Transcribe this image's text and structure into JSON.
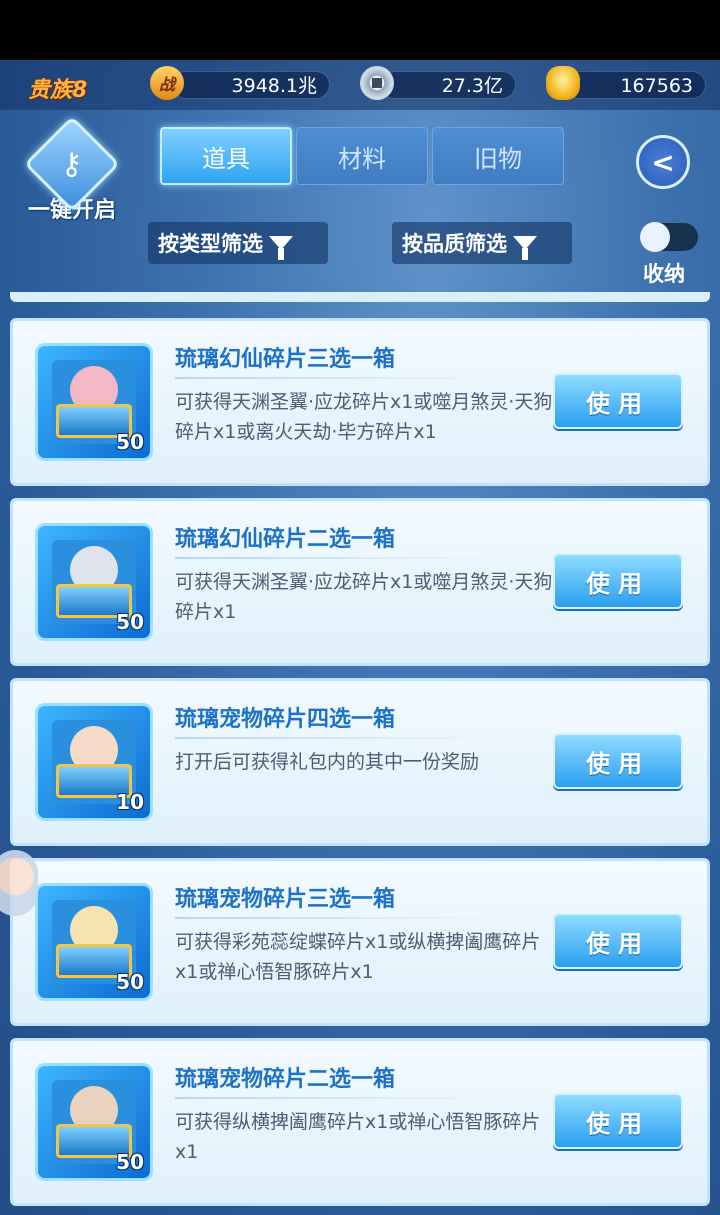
{
  "header": {
    "vip_label": "贵族8",
    "stats": [
      {
        "icon": "battle-power-icon",
        "icon_text": "战",
        "value": "3948.1兆"
      },
      {
        "icon": "coin-icon",
        "icon_text": "",
        "value": "27.3亿"
      },
      {
        "icon": "gold-ingot-icon",
        "icon_text": "",
        "value": "167563"
      }
    ]
  },
  "controls": {
    "one_key_open": "一键开启",
    "tabs": [
      {
        "label": "道具",
        "active": true
      },
      {
        "label": "材料",
        "active": false
      },
      {
        "label": "旧物",
        "active": false
      }
    ],
    "filter_type": "按类型筛选",
    "filter_quality": "按品质筛选",
    "collapse_label": "收纳"
  },
  "items": [
    {
      "title": "琉璃幻仙碎片三选一箱",
      "desc": "可获得天渊圣翼·应龙碎片x1或噬月煞灵·天狗碎片x1或离火天劫·毕方碎片x1",
      "count": "50",
      "use": "使用",
      "face_color": "#f3b7c6"
    },
    {
      "title": "琉璃幻仙碎片二选一箱",
      "desc": "可获得天渊圣翼·应龙碎片x1或噬月煞灵·天狗碎片x1",
      "count": "50",
      "use": "使用",
      "face_color": "#dfe3ea"
    },
    {
      "title": "琉璃宠物碎片四选一箱",
      "desc": "打开后可获得礼包内的其中一份奖励",
      "count": "10",
      "use": "使用",
      "face_color": "#f6dcc8"
    },
    {
      "title": "琉璃宠物碎片三选一箱",
      "desc": "可获得彩苑蕊绽蝶碎片x1或纵横捭阖鹰碎片x1或禅心悟智豚碎片x1",
      "count": "50",
      "use": "使用",
      "face_color": "#f7e3b0"
    },
    {
      "title": "琉璃宠物碎片二选一箱",
      "desc": "可获得纵横捭阖鹰碎片x1或禅心悟智豚碎片x1",
      "count": "50",
      "use": "使用",
      "face_color": "#e9d2bf"
    }
  ]
}
